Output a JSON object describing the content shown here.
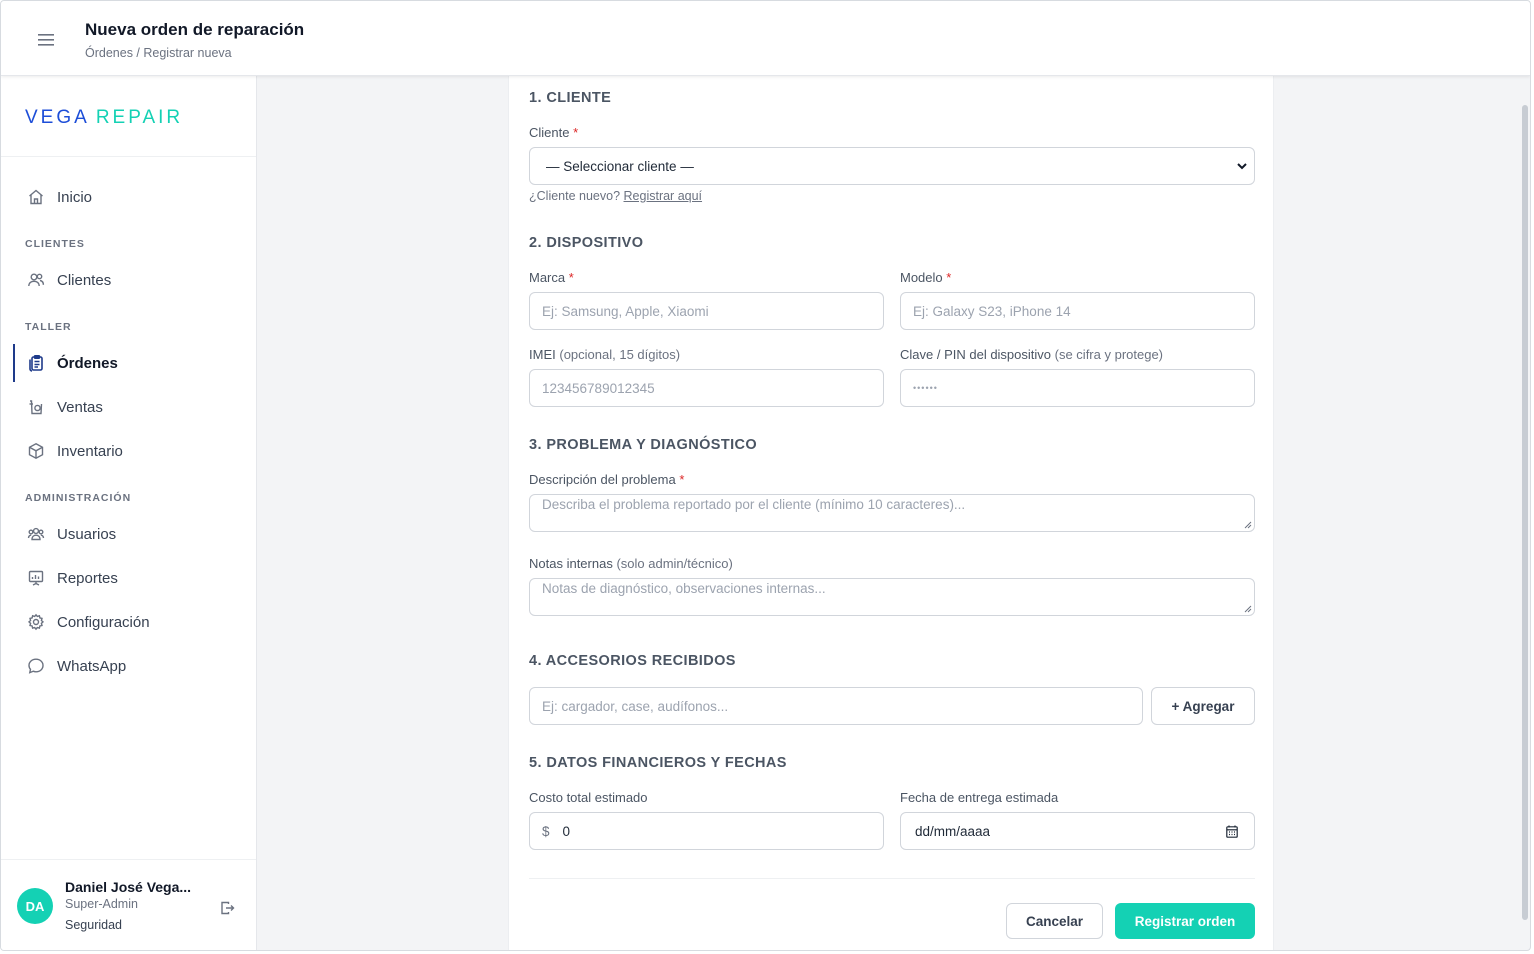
{
  "header": {
    "title": "Nueva orden de reparación",
    "breadcrumb": "Órdenes / Registrar nueva",
    "menu_icon": "hamburger-icon"
  },
  "brand": {
    "part1": "VEGA",
    "part2": "REPAIR",
    "accent": "#14d1b4",
    "primary": "#1d4ed8"
  },
  "sidebar": {
    "items": [
      {
        "label": "Inicio",
        "icon": "home-icon"
      },
      {
        "label": "Clientes",
        "icon": "users-icon"
      },
      {
        "label": "Órdenes",
        "icon": "clipboard-icon",
        "active": true
      },
      {
        "label": "Ventas",
        "icon": "shopping-bag-icon"
      },
      {
        "label": "Inventario",
        "icon": "box-icon"
      },
      {
        "label": "Usuarios",
        "icon": "team-icon"
      },
      {
        "label": "Reportes",
        "icon": "chart-board-icon"
      },
      {
        "label": "Configuración",
        "icon": "gear-icon"
      },
      {
        "label": "WhatsApp",
        "icon": "chat-bubble-icon"
      }
    ],
    "sections": {
      "clientes": "CLIENTES",
      "taller": "TALLER",
      "admin": "ADMINISTRACIÓN"
    }
  },
  "user": {
    "initials": "DA",
    "name": "Daniel José Vega...",
    "role": "Super-Admin",
    "dept": "Seguridad"
  },
  "form": {
    "s1": {
      "title": "1. CLIENTE",
      "client_label": "Cliente",
      "req": "*",
      "client_value": "— Seleccionar cliente —",
      "help_text": "¿Cliente nuevo?",
      "help_link": "Registrar aquí"
    },
    "s2": {
      "title": "2. DISPOSITIVO",
      "brand_label": "Marca",
      "brand_placeholder": "Ej: Samsung, Apple, Xiaomi",
      "model_label": "Modelo",
      "model_placeholder": "Ej: Galaxy S23, iPhone 14",
      "imei_label": "IMEI",
      "imei_hint": "(opcional, 15 dígitos)",
      "imei_placeholder": "123456789012345",
      "pin_label": "Clave / PIN del dispositivo",
      "pin_hint": "(se cifra y protege)",
      "pin_placeholder": "••••••"
    },
    "s3": {
      "title": "3. PROBLEMA Y DIAGNÓSTICO",
      "desc_label": "Descripción del problema",
      "desc_placeholder": "Describa el problema reportado por el cliente (mínimo 10 caracteres)...",
      "notes_label": "Notas internas",
      "notes_hint": "(solo admin/técnico)",
      "notes_placeholder": "Notas de diagnóstico, observaciones internas..."
    },
    "s4": {
      "title": "4. ACCESORIOS RECIBIDOS",
      "placeholder": "Ej: cargador, case, audífonos...",
      "add_label": "+ Agregar"
    },
    "s5": {
      "title": "5. DATOS FINANCIEROS Y FECHAS",
      "cost_label": "Costo total estimado",
      "currency": "$",
      "cost_value": "0",
      "date_label": "Fecha de entrega estimada",
      "date_value": "dd/mm/aaaa"
    },
    "actions": {
      "cancel": "Cancelar",
      "submit": "Registrar orden"
    }
  }
}
